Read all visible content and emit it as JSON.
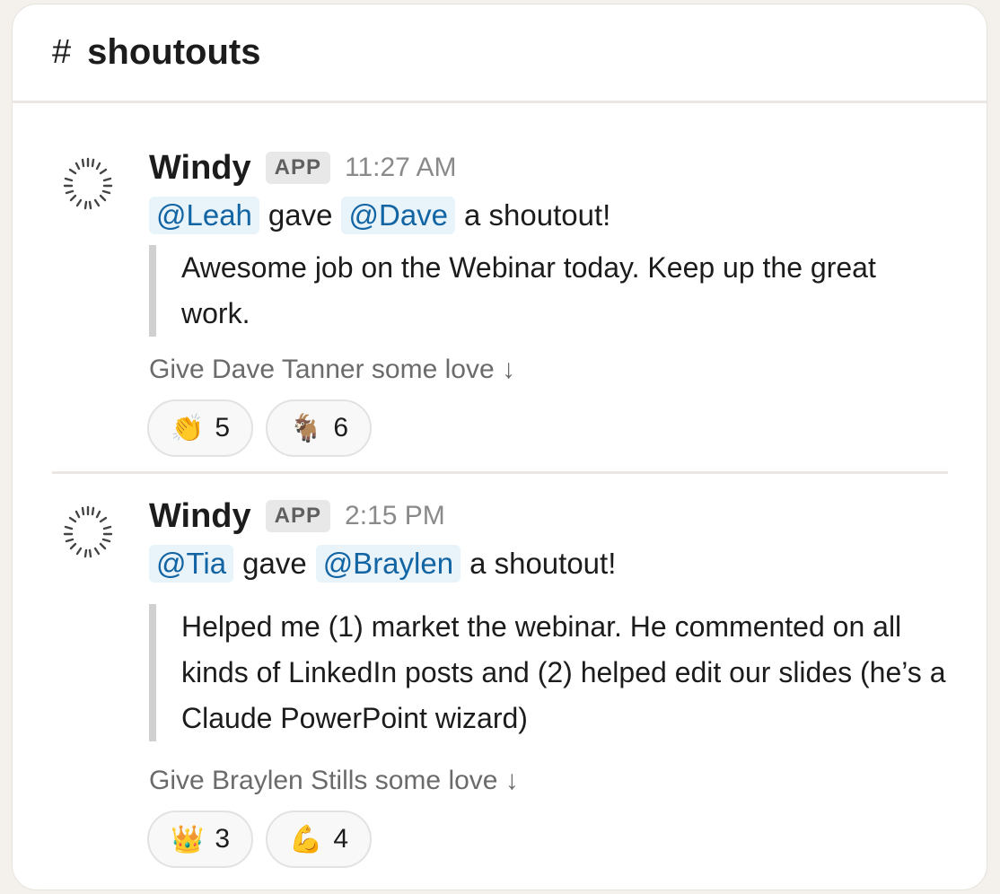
{
  "channel": {
    "hash": "#",
    "name": "shoutouts"
  },
  "messages": [
    {
      "sender": "Windy",
      "badge": "APP",
      "time": "11:27 AM",
      "giver": "@Leah",
      "verb": "gave",
      "receiver": "@Dave",
      "tail": "a shoutout!",
      "quote": "Awesome job on the Webinar today. Keep up the great work.",
      "love_prompt": "Give Dave Tanner some love ↓",
      "reactions": [
        {
          "emoji": "👏",
          "emoji_name": "clapping-hands-icon",
          "count": "5"
        },
        {
          "emoji": "🐐",
          "emoji_name": "goat-icon",
          "count": "6"
        }
      ]
    },
    {
      "sender": "Windy",
      "badge": "APP",
      "time": "2:15 PM",
      "giver": "@Tia",
      "verb": "gave",
      "receiver": "@Braylen",
      "tail": "a shoutout!",
      "quote": "Helped me (1) market the webinar. He commented on all kinds of LinkedIn posts and (2) helped edit our slides (he’s a Claude PowerPoint wizard)",
      "love_prompt": "Give Braylen Stills some love ↓",
      "reactions": [
        {
          "emoji": "👑",
          "emoji_name": "crown-icon",
          "count": "3"
        },
        {
          "emoji": "💪",
          "emoji_name": "flexed-biceps-icon",
          "count": "4"
        }
      ]
    }
  ],
  "colors": {
    "mention_bg": "#e8f3fa",
    "mention_text": "#1264a3",
    "quote_bar": "#d0d0d0"
  }
}
